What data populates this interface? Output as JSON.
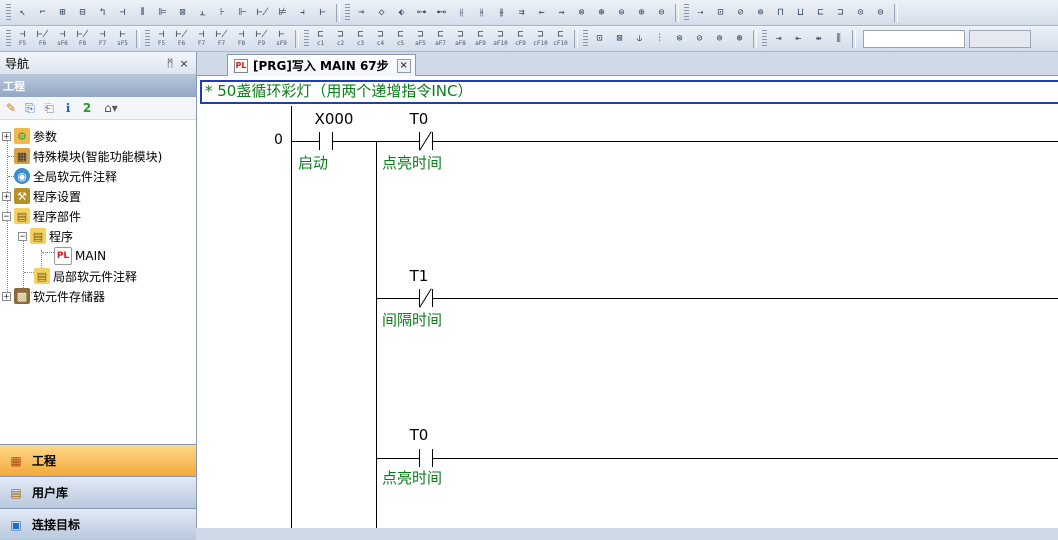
{
  "toolbar1": {
    "groups": [
      [
        {
          "g": "↖"
        },
        {
          "g": "⌐"
        },
        {
          "g": "⊞"
        },
        {
          "g": "⊟"
        },
        {
          "g": "↰"
        },
        {
          "g": "⊣"
        },
        {
          "g": "⫴"
        },
        {
          "g": "⊫"
        },
        {
          "g": "⊠"
        },
        {
          "g": "⫠"
        },
        {
          "g": "⊦"
        },
        {
          "g": "⊩"
        },
        {
          "g": "⊬"
        },
        {
          "g": "⊭"
        },
        {
          "g": "⫞"
        },
        {
          "g": "⊢"
        }
      ],
      [
        {
          "g": "⊸"
        },
        {
          "g": "◇"
        },
        {
          "g": "⬖"
        },
        {
          "g": "⊶"
        },
        {
          "g": "⊷"
        },
        {
          "g": "⫲"
        },
        {
          "g": "⫳"
        },
        {
          "g": "⫵"
        },
        {
          "g": "⇉"
        },
        {
          "g": "⇜"
        },
        {
          "g": "⇝"
        },
        {
          "g": "⊗"
        },
        {
          "g": "⊛"
        },
        {
          "g": "⊜"
        },
        {
          "g": "⊕"
        },
        {
          "g": "⊖"
        }
      ],
      [
        {
          "g": "⇢"
        },
        {
          "g": "⊡"
        },
        {
          "g": "⊘"
        },
        {
          "g": "⊚"
        },
        {
          "g": "⊓"
        },
        {
          "g": "⊔"
        },
        {
          "g": "⊏"
        },
        {
          "g": "⊐"
        },
        {
          "g": "⊙"
        },
        {
          "g": "⊖"
        }
      ]
    ]
  },
  "toolbar2": {
    "groups": [
      [
        {
          "g": "⊣",
          "s": "F5"
        },
        {
          "g": "⊬",
          "s": "F6"
        },
        {
          "g": "⊣",
          "s": "sF6"
        },
        {
          "g": "⊬",
          "s": "F8"
        },
        {
          "g": "⊣",
          "s": "F7"
        },
        {
          "g": "⊢",
          "s": "sF5"
        }
      ],
      [
        {
          "g": "⊣",
          "s": "F5"
        },
        {
          "g": "⊬",
          "s": "F6"
        },
        {
          "g": "⊣",
          "s": "F7"
        },
        {
          "g": "⊬",
          "s": "F7"
        },
        {
          "g": "⊣",
          "s": "F8"
        },
        {
          "g": "⊬",
          "s": "F9"
        },
        {
          "g": "⊢",
          "s": "sF9"
        }
      ],
      [
        {
          "g": "⊏",
          "s": "c1"
        },
        {
          "g": "⊐",
          "s": "c2"
        },
        {
          "g": "⊏",
          "s": "c3"
        },
        {
          "g": "⊐",
          "s": "c4"
        },
        {
          "g": "⊏",
          "s": "c5"
        },
        {
          "g": "⊐",
          "s": "aF5"
        },
        {
          "g": "⊏",
          "s": "aF7"
        },
        {
          "g": "⊐",
          "s": "aF8"
        },
        {
          "g": "⊏",
          "s": "aF9"
        },
        {
          "g": "⊐",
          "s": "aF10"
        },
        {
          "g": "⊏",
          "s": "cF9"
        },
        {
          "g": "⊐",
          "s": "cF10"
        },
        {
          "g": "⊏",
          "s": "cF10"
        }
      ],
      [
        {
          "g": "⊡"
        },
        {
          "g": "⊠"
        },
        {
          "g": "⫝"
        },
        {
          "g": "⫶"
        },
        {
          "g": "⊗"
        },
        {
          "g": "⊘"
        },
        {
          "g": "⊚"
        },
        {
          "g": "⊛"
        }
      ],
      [
        {
          "g": "⇥"
        },
        {
          "g": "⇤"
        },
        {
          "g": "⇹"
        },
        {
          "g": "⫼"
        }
      ]
    ]
  },
  "nav": {
    "title": "导航",
    "pin": "ᛗ",
    "close": "×",
    "section": "工程",
    "tools": [
      "✎",
      "⎘",
      "⎗",
      "ℹ",
      "2",
      "⌂▾"
    ],
    "tree": [
      {
        "label": "参数",
        "expander": "+",
        "icon": "⚙"
      },
      {
        "label": "特殊模块(智能功能模块)",
        "icon": "▦"
      },
      {
        "label": "全局软元件注释",
        "icon": "◉"
      },
      {
        "label": "程序设置",
        "expander": "+",
        "icon": "⚒"
      },
      {
        "label": "程序部件",
        "expander": "−",
        "icon": "▤"
      },
      {
        "label": "程序",
        "expander": "−",
        "icon": "▤"
      },
      {
        "label": "MAIN",
        "icon": "PL"
      },
      {
        "label": "局部软元件注释",
        "icon": "▤"
      },
      {
        "label": "软元件存储器",
        "expander": "+",
        "icon": "▩"
      }
    ],
    "bottom": [
      {
        "label": "工程",
        "icon": "▦"
      },
      {
        "label": "用户库",
        "icon": "▤"
      },
      {
        "label": "连接目标",
        "icon": "▣"
      }
    ]
  },
  "document_tab": {
    "icon": "PL",
    "label": "[PRG]写入 MAIN 67步",
    "close": "×"
  },
  "editor": {
    "statement_comment": "* 50盏循环彩灯（用两个递增指令INC）",
    "step": "0",
    "rungs": [
      {
        "device": "X000",
        "type": "no",
        "comment": "启动"
      },
      {
        "device": "T0",
        "type": "nc",
        "comment": "点亮时间"
      },
      {
        "device": "T1",
        "type": "nc",
        "comment": "间隔时间"
      },
      {
        "device": "T0",
        "type": "no",
        "comment": "点亮时间"
      }
    ]
  }
}
